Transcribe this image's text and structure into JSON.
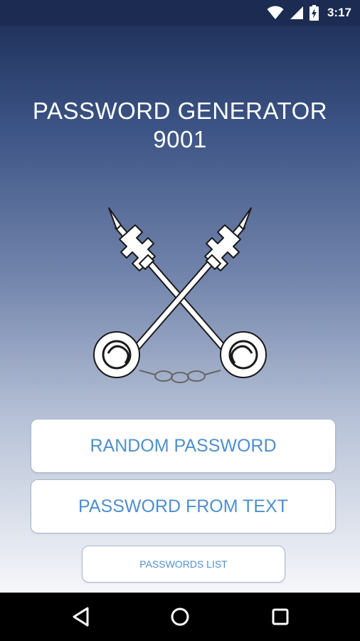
{
  "status_bar": {
    "time": "3:17",
    "icons": [
      "wifi-icon",
      "cellular-signal-icon",
      "battery-charging-icon"
    ]
  },
  "app": {
    "title_line1": "PASSWORD GENERATOR",
    "title_line2": "9001",
    "emblem": "crossed-keys-icon",
    "buttons": {
      "random_password": "RANDOM PASSWORD",
      "password_from_text": "PASSWORD FROM TEXT",
      "passwords_list": "PASSWORDS LIST"
    }
  },
  "nav_bar": {
    "icons": [
      "back-icon",
      "home-icon",
      "recents-icon"
    ]
  },
  "colors": {
    "status_bar": "#1b2b52",
    "gradient_top": "#21335e",
    "gradient_bottom": "#f6f7fa",
    "button_text": "#4e8fcd",
    "button_border": "#a9b7cc",
    "nav_bar": "#000000"
  }
}
